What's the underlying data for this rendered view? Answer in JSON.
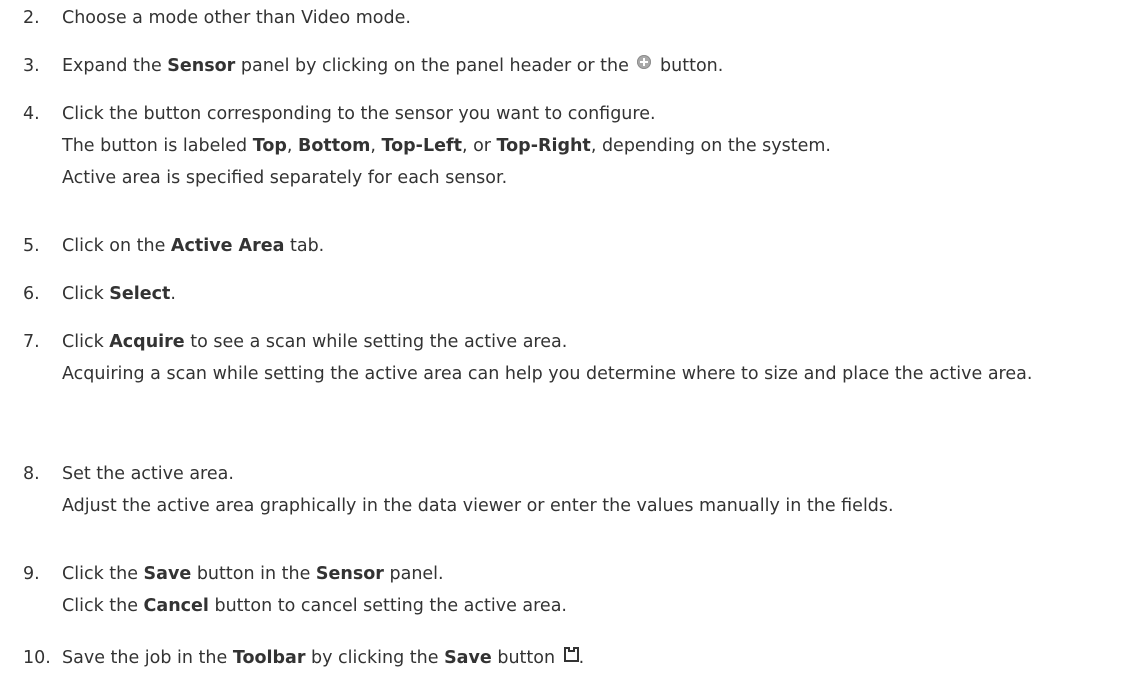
{
  "steps": [
    {
      "number": "2.",
      "lines": [
        {
          "parts": [
            {
              "text": "Choose a mode other than Video mode."
            }
          ]
        }
      ]
    },
    {
      "number": "3.",
      "lines": [
        {
          "parts": [
            {
              "text": "Expand the "
            },
            {
              "text": "Sensor",
              "bold": true
            },
            {
              "text": " panel by clicking on the panel header or the "
            },
            {
              "icon": "plus-circle-icon"
            },
            {
              "text": " button."
            }
          ]
        }
      ]
    },
    {
      "number": "4.",
      "lines": [
        {
          "parts": [
            {
              "text": "Click the button corresponding to the sensor you want to configure."
            }
          ]
        },
        {
          "parts": [
            {
              "text": "The button is labeled "
            },
            {
              "text": "Top",
              "bold": true
            },
            {
              "text": ", "
            },
            {
              "text": "Bottom",
              "bold": true
            },
            {
              "text": ", "
            },
            {
              "text": "Top-Left",
              "bold": true
            },
            {
              "text": ", or "
            },
            {
              "text": "Top-Right",
              "bold": true
            },
            {
              "text": ", depending on the system."
            }
          ]
        },
        {
          "parts": [
            {
              "text": "Active area is specified separately for each sensor."
            }
          ]
        }
      ]
    },
    {
      "number": "5.",
      "lines": [
        {
          "parts": [
            {
              "text": "Click on the "
            },
            {
              "text": "Active Area",
              "bold": true
            },
            {
              "text": " tab."
            }
          ]
        }
      ]
    },
    {
      "number": "6.",
      "lines": [
        {
          "parts": [
            {
              "text": "Click "
            },
            {
              "text": "Select",
              "bold": true
            },
            {
              "text": "."
            }
          ]
        }
      ]
    },
    {
      "number": "7.",
      "lines": [
        {
          "parts": [
            {
              "text": "Click "
            },
            {
              "text": "Acquire",
              "bold": true
            },
            {
              "text": " to see a scan while setting the active area."
            }
          ]
        },
        {
          "wrap": true,
          "parts": [
            {
              "text": "Acquiring a scan while setting the active area can help you determine where to size and place the active area."
            }
          ]
        }
      ]
    },
    {
      "number": "8.",
      "lines": [
        {
          "parts": [
            {
              "text": "Set the active area."
            }
          ]
        },
        {
          "parts": [
            {
              "text": "Adjust the active area graphically in the data viewer or enter the values manually in the fields."
            }
          ]
        }
      ]
    },
    {
      "number": "9.",
      "lines": [
        {
          "parts": [
            {
              "text": "Click the "
            },
            {
              "text": "Save",
              "bold": true
            },
            {
              "text": " button in the "
            },
            {
              "text": "Sensor",
              "bold": true
            },
            {
              "text": " panel."
            }
          ]
        },
        {
          "parts": [
            {
              "text": "Click the "
            },
            {
              "text": "Cancel",
              "bold": true
            },
            {
              "text": " button to cancel setting the active area."
            }
          ]
        }
      ]
    },
    {
      "number": "10.",
      "lines": [
        {
          "parts": [
            {
              "text": "Save the job in the "
            },
            {
              "text": "Toolbar",
              "bold": true
            },
            {
              "text": " by clicking the "
            },
            {
              "text": "Save",
              "bold": true
            },
            {
              "text": " button "
            },
            {
              "icon": "save-icon"
            },
            {
              "text": "."
            }
          ]
        }
      ]
    }
  ]
}
